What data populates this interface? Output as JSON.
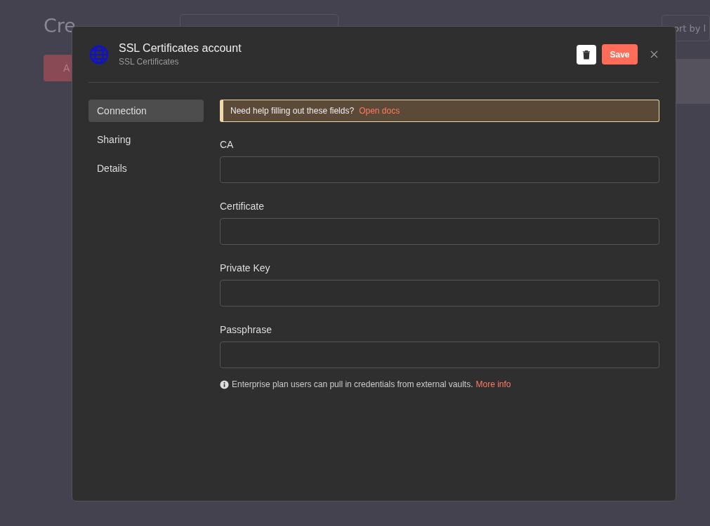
{
  "background": {
    "heading": "Cre",
    "add_button": "A",
    "sort": "ort by l"
  },
  "dialog": {
    "title": "SSL Certificates account",
    "subtitle": "SSL Certificates",
    "save": "Save",
    "tabs": [
      {
        "label": "Connection",
        "selected": true
      },
      {
        "label": "Sharing",
        "selected": false
      },
      {
        "label": "Details",
        "selected": false
      }
    ],
    "notice": {
      "text": "Need help filling out these fields?",
      "link": "Open docs"
    },
    "fields": [
      {
        "label": "CA"
      },
      {
        "label": "Certificate"
      },
      {
        "label": "Private Key"
      },
      {
        "label": "Passphrase"
      }
    ],
    "info": {
      "text": "Enterprise plan users can pull in credentials from external vaults.",
      "link": "More info"
    }
  }
}
